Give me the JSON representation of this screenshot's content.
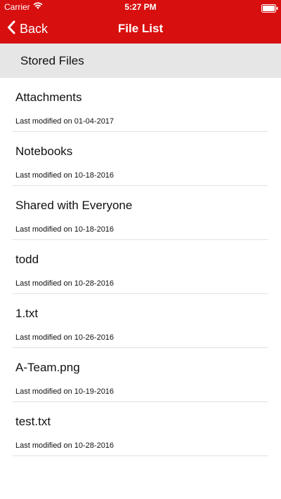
{
  "status": {
    "carrier": "Carrier",
    "time": "5:27 PM"
  },
  "nav": {
    "back_label": "Back",
    "title": "File List"
  },
  "section": {
    "title": "Stored Files"
  },
  "files": [
    {
      "name": "Attachments",
      "modified": "Last modified on 01-04-2017"
    },
    {
      "name": "Notebooks",
      "modified": "Last modified on 10-18-2016"
    },
    {
      "name": "Shared with Everyone",
      "modified": "Last modified on 10-18-2016"
    },
    {
      "name": "todd",
      "modified": "Last modified on 10-28-2016"
    },
    {
      "name": "1.txt",
      "modified": "Last modified on 10-26-2016"
    },
    {
      "name": "A-Team.png",
      "modified": "Last modified on 10-19-2016"
    },
    {
      "name": "test.txt",
      "modified": "Last modified on 10-28-2016"
    }
  ],
  "colors": {
    "brand": "#d80f0f",
    "section_bg": "#e6e6e6",
    "divider": "#e2e2e2"
  },
  "icons": [
    "wifi-icon",
    "battery-icon",
    "chevron-left-icon"
  ]
}
